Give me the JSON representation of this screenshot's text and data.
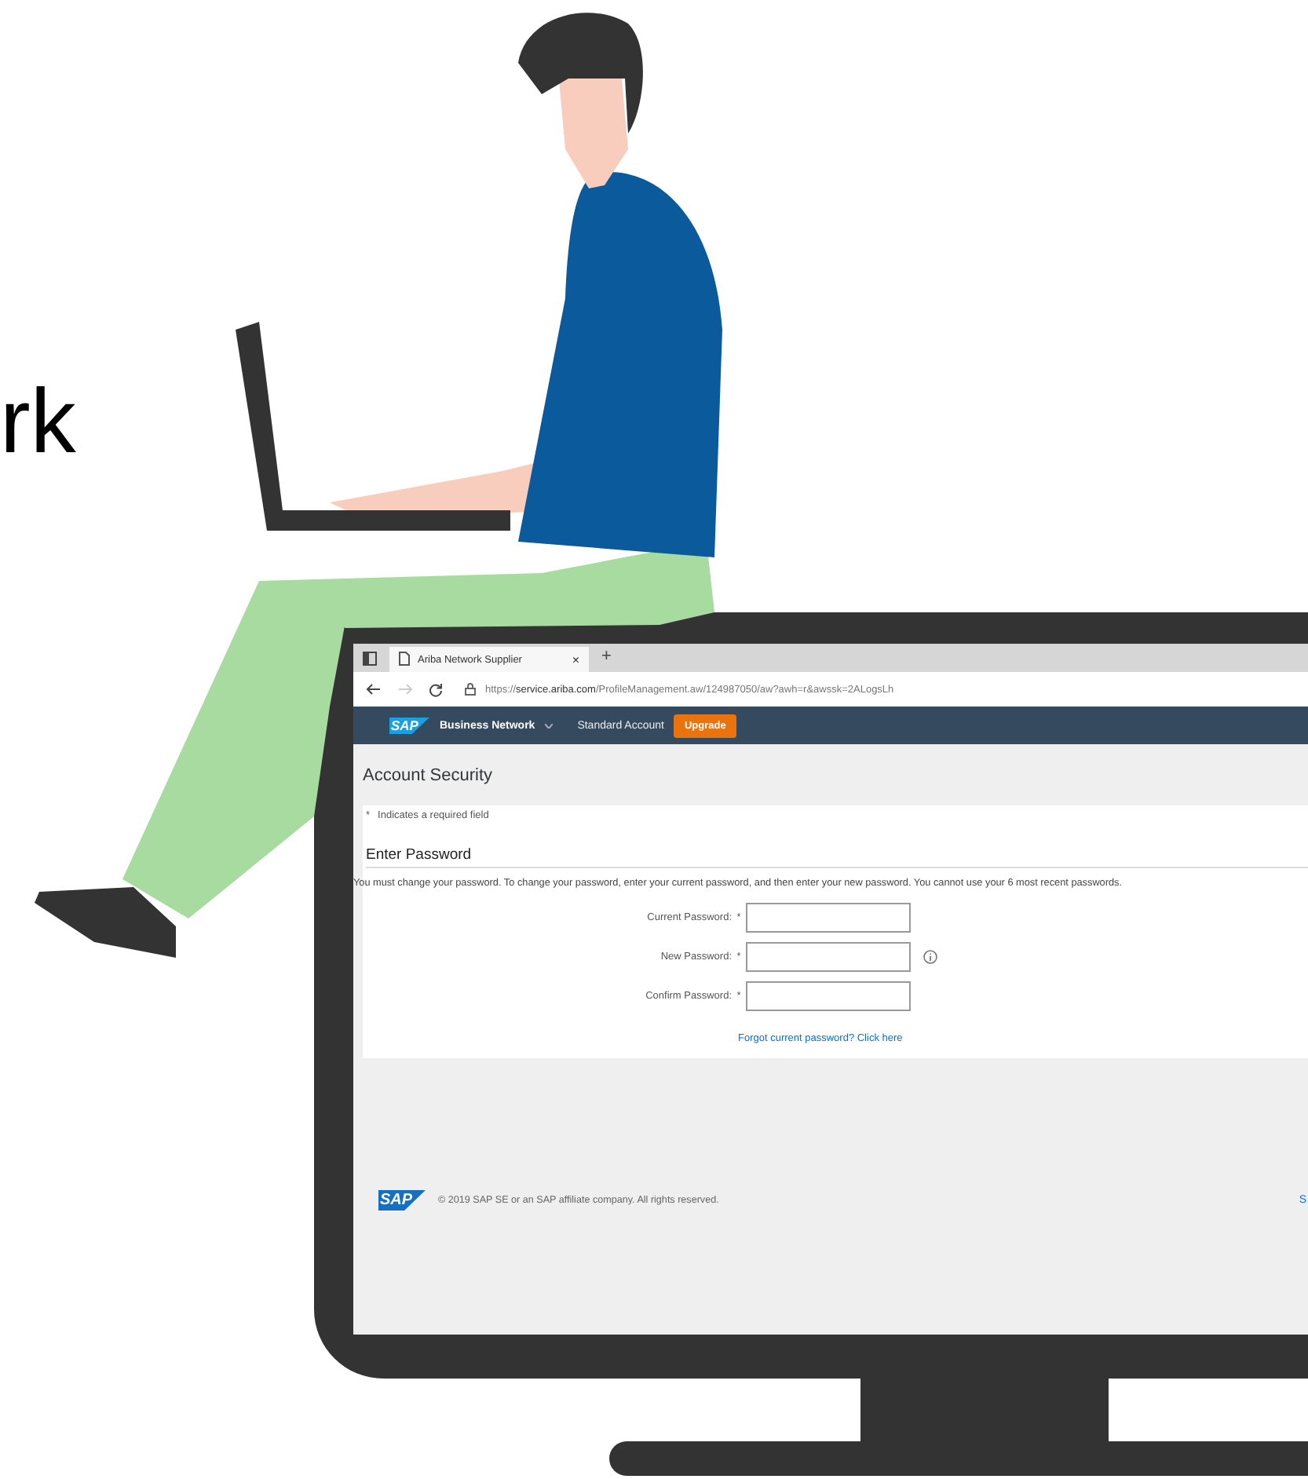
{
  "headline": "rk",
  "browser": {
    "tab_title": "Ariba Network Supplier",
    "close": "×",
    "new_tab": "+",
    "url": "https://**service.ariba.com**/ProfileManagement.aw/124987050/aw?awh=r&awssk=2ALogsLh",
    "forward_disabled": true
  },
  "nav": {
    "logo": "SAP",
    "brand": "Business Network",
    "items": [
      "Standard Account"
    ],
    "upgrade": "Upgrade"
  },
  "page": {
    "title": "Account Security",
    "required_mark": "*",
    "required_note": "Indicates a required field",
    "section": "Enter Password",
    "instructions": "You must change your password. To change your password, enter your current password, and then enter your new password. You cannot use your 6 most recent passwords.",
    "fields": [
      {
        "label": "Current Password:",
        "required": true,
        "info": false
      },
      {
        "label": "New Password:",
        "required": true,
        "info": true
      },
      {
        "label": "Confirm Password:",
        "required": true,
        "info": false
      }
    ],
    "link": "Forgot current password? Click here"
  },
  "footer": {
    "logo": "SAP",
    "copyright": "© 2019 SAP SE or an SAP affiliate company. All rights reserved.",
    "link": "S"
  }
}
